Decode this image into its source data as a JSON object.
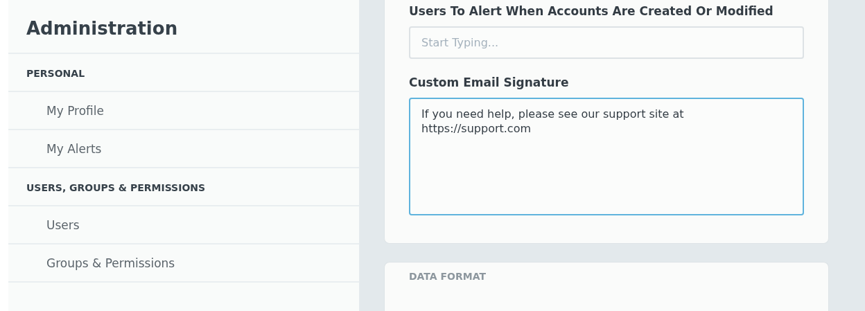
{
  "sidebar": {
    "title": "Administration",
    "sections": [
      {
        "heading": "PERSONAL",
        "items": [
          "My Profile",
          "My Alerts"
        ]
      },
      {
        "heading": "USERS, GROUPS & PERMISSIONS",
        "items": [
          "Users",
          "Groups & Permissions"
        ]
      }
    ]
  },
  "settings_card": {
    "fields": [
      {
        "kind": "input",
        "label": "Users To Alert When Accounts Are Created Or Modified",
        "placeholder": "Start Typing...",
        "focused": false
      },
      {
        "kind": "textarea",
        "label": "Custom Email Signature",
        "value": "If you need help, please see our support site at\nhttps://support.com",
        "focused": true
      }
    ]
  },
  "data_format_card": {
    "heading": "DATA FORMAT"
  }
}
